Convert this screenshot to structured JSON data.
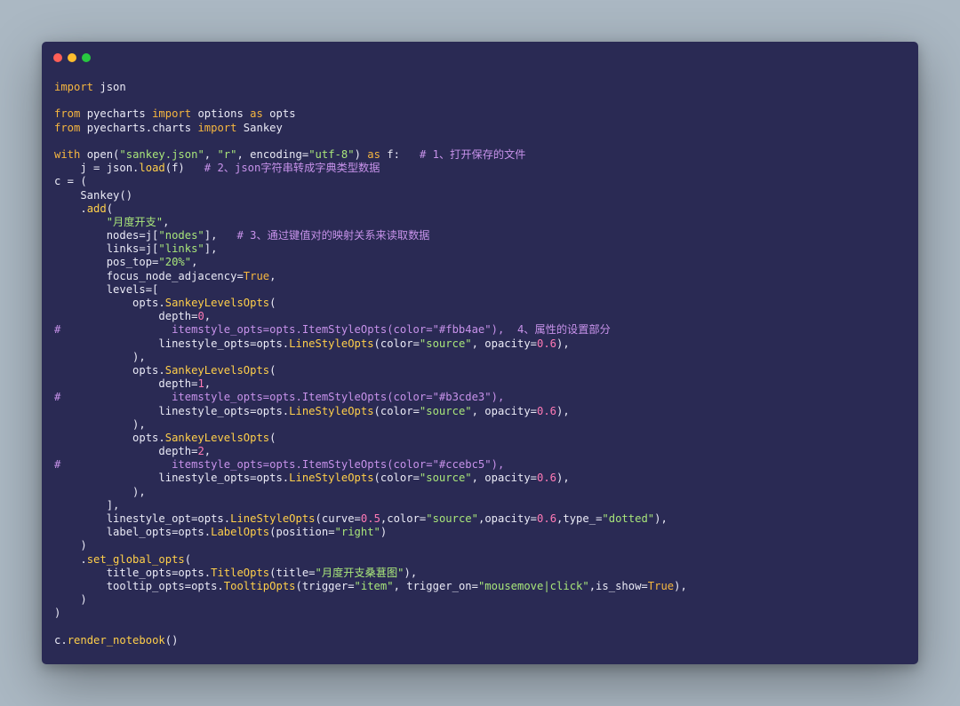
{
  "window": {
    "controls": [
      {
        "name": "close",
        "color": "#ff5f57"
      },
      {
        "name": "minimize",
        "color": "#ffbd2e"
      },
      {
        "name": "maximize",
        "color": "#28c840"
      }
    ]
  },
  "colors": {
    "background": "#abb8c3",
    "editor": "#2a2a54",
    "keyword": "#f6b63f",
    "string": "#a8e57a",
    "number": "#ff7ab6",
    "function": "#ffcf4a",
    "comment": "#c792ea",
    "text": "#eaeaf6"
  },
  "code": {
    "lines": [
      [
        {
          "t": "import",
          "c": "kw"
        },
        {
          "t": " json",
          "c": "id"
        }
      ],
      [],
      [
        {
          "t": "from",
          "c": "kw"
        },
        {
          "t": " pyecharts ",
          "c": "id"
        },
        {
          "t": "import",
          "c": "kw"
        },
        {
          "t": " options ",
          "c": "id"
        },
        {
          "t": "as",
          "c": "kw"
        },
        {
          "t": " opts",
          "c": "id"
        }
      ],
      [
        {
          "t": "from",
          "c": "kw"
        },
        {
          "t": " pyecharts.charts ",
          "c": "id"
        },
        {
          "t": "import",
          "c": "kw"
        },
        {
          "t": " Sankey",
          "c": "id"
        }
      ],
      [],
      [
        {
          "t": "with",
          "c": "kw"
        },
        {
          "t": " open(",
          "c": "id"
        },
        {
          "t": "\"sankey.json\"",
          "c": "str"
        },
        {
          "t": ", ",
          "c": "id"
        },
        {
          "t": "\"r\"",
          "c": "str"
        },
        {
          "t": ", encoding=",
          "c": "id"
        },
        {
          "t": "\"utf-8\"",
          "c": "str"
        },
        {
          "t": ") ",
          "c": "id"
        },
        {
          "t": "as",
          "c": "kw"
        },
        {
          "t": " f:   ",
          "c": "id"
        },
        {
          "t": "# 1、打开保存的文件",
          "c": "cm"
        }
      ],
      [
        {
          "t": "    j = json.",
          "c": "id"
        },
        {
          "t": "load",
          "c": "fn"
        },
        {
          "t": "(f)   ",
          "c": "id"
        },
        {
          "t": "# 2、json字符串转成字典类型数据",
          "c": "cm"
        }
      ],
      [
        {
          "t": "c = (",
          "c": "id"
        }
      ],
      [
        {
          "t": "    Sankey()",
          "c": "id"
        }
      ],
      [
        {
          "t": "    .",
          "c": "id"
        },
        {
          "t": "add",
          "c": "fn"
        },
        {
          "t": "(",
          "c": "id"
        }
      ],
      [
        {
          "t": "        ",
          "c": "id"
        },
        {
          "t": "\"月度开支\"",
          "c": "str"
        },
        {
          "t": ",",
          "c": "id"
        }
      ],
      [
        {
          "t": "        nodes=j[",
          "c": "id"
        },
        {
          "t": "\"nodes\"",
          "c": "str"
        },
        {
          "t": "],   ",
          "c": "id"
        },
        {
          "t": "# 3、通过键值对的映射关系来读取数据",
          "c": "cm"
        }
      ],
      [
        {
          "t": "        links=j[",
          "c": "id"
        },
        {
          "t": "\"links\"",
          "c": "str"
        },
        {
          "t": "],",
          "c": "id"
        }
      ],
      [
        {
          "t": "        pos_top=",
          "c": "id"
        },
        {
          "t": "\"20%\"",
          "c": "str"
        },
        {
          "t": ",",
          "c": "id"
        }
      ],
      [
        {
          "t": "        focus_node_adjacency=",
          "c": "id"
        },
        {
          "t": "True",
          "c": "kw"
        },
        {
          "t": ",",
          "c": "id"
        }
      ],
      [
        {
          "t": "        levels=[",
          "c": "id"
        }
      ],
      [
        {
          "t": "            opts.",
          "c": "id"
        },
        {
          "t": "SankeyLevelsOpts",
          "c": "fn"
        },
        {
          "t": "(",
          "c": "id"
        }
      ],
      [
        {
          "t": "                depth=",
          "c": "id"
        },
        {
          "t": "0",
          "c": "num"
        },
        {
          "t": ",",
          "c": "id"
        }
      ],
      [
        {
          "t": "#                 itemstyle_opts=opts.ItemStyleOpts(color=\"#fbb4ae\"),  4、属性的设置部分",
          "c": "cm"
        }
      ],
      [
        {
          "t": "                linestyle_opts=opts.",
          "c": "id"
        },
        {
          "t": "LineStyleOpts",
          "c": "fn"
        },
        {
          "t": "(color=",
          "c": "id"
        },
        {
          "t": "\"source\"",
          "c": "str"
        },
        {
          "t": ", opacity=",
          "c": "id"
        },
        {
          "t": "0.6",
          "c": "num"
        },
        {
          "t": "),",
          "c": "id"
        }
      ],
      [
        {
          "t": "            ),",
          "c": "id"
        }
      ],
      [
        {
          "t": "            opts.",
          "c": "id"
        },
        {
          "t": "SankeyLevelsOpts",
          "c": "fn"
        },
        {
          "t": "(",
          "c": "id"
        }
      ],
      [
        {
          "t": "                depth=",
          "c": "id"
        },
        {
          "t": "1",
          "c": "num"
        },
        {
          "t": ",",
          "c": "id"
        }
      ],
      [
        {
          "t": "#                 itemstyle_opts=opts.ItemStyleOpts(color=\"#b3cde3\"),",
          "c": "cm"
        }
      ],
      [
        {
          "t": "                linestyle_opts=opts.",
          "c": "id"
        },
        {
          "t": "LineStyleOpts",
          "c": "fn"
        },
        {
          "t": "(color=",
          "c": "id"
        },
        {
          "t": "\"source\"",
          "c": "str"
        },
        {
          "t": ", opacity=",
          "c": "id"
        },
        {
          "t": "0.6",
          "c": "num"
        },
        {
          "t": "),",
          "c": "id"
        }
      ],
      [
        {
          "t": "            ),",
          "c": "id"
        }
      ],
      [
        {
          "t": "            opts.",
          "c": "id"
        },
        {
          "t": "SankeyLevelsOpts",
          "c": "fn"
        },
        {
          "t": "(",
          "c": "id"
        }
      ],
      [
        {
          "t": "                depth=",
          "c": "id"
        },
        {
          "t": "2",
          "c": "num"
        },
        {
          "t": ",",
          "c": "id"
        }
      ],
      [
        {
          "t": "#                 itemstyle_opts=opts.ItemStyleOpts(color=\"#ccebc5\"),",
          "c": "cm"
        }
      ],
      [
        {
          "t": "                linestyle_opts=opts.",
          "c": "id"
        },
        {
          "t": "LineStyleOpts",
          "c": "fn"
        },
        {
          "t": "(color=",
          "c": "id"
        },
        {
          "t": "\"source\"",
          "c": "str"
        },
        {
          "t": ", opacity=",
          "c": "id"
        },
        {
          "t": "0.6",
          "c": "num"
        },
        {
          "t": "),",
          "c": "id"
        }
      ],
      [
        {
          "t": "            ),",
          "c": "id"
        }
      ],
      [
        {
          "t": "        ],",
          "c": "id"
        }
      ],
      [
        {
          "t": "        linestyle_opt=opts.",
          "c": "id"
        },
        {
          "t": "LineStyleOpts",
          "c": "fn"
        },
        {
          "t": "(curve=",
          "c": "id"
        },
        {
          "t": "0.5",
          "c": "num"
        },
        {
          "t": ",color=",
          "c": "id"
        },
        {
          "t": "\"source\"",
          "c": "str"
        },
        {
          "t": ",opacity=",
          "c": "id"
        },
        {
          "t": "0.6",
          "c": "num"
        },
        {
          "t": ",type_=",
          "c": "id"
        },
        {
          "t": "\"dotted\"",
          "c": "str"
        },
        {
          "t": "),",
          "c": "id"
        }
      ],
      [
        {
          "t": "        label_opts=opts.",
          "c": "id"
        },
        {
          "t": "LabelOpts",
          "c": "fn"
        },
        {
          "t": "(position=",
          "c": "id"
        },
        {
          "t": "\"right\"",
          "c": "str"
        },
        {
          "t": ")",
          "c": "id"
        }
      ],
      [
        {
          "t": "    )",
          "c": "id"
        }
      ],
      [
        {
          "t": "    .",
          "c": "id"
        },
        {
          "t": "set_global_opts",
          "c": "fn"
        },
        {
          "t": "(",
          "c": "id"
        }
      ],
      [
        {
          "t": "        title_opts=opts.",
          "c": "id"
        },
        {
          "t": "TitleOpts",
          "c": "fn"
        },
        {
          "t": "(title=",
          "c": "id"
        },
        {
          "t": "\"月度开支桑葚图\"",
          "c": "str"
        },
        {
          "t": "),",
          "c": "id"
        }
      ],
      [
        {
          "t": "        tooltip_opts=opts.",
          "c": "id"
        },
        {
          "t": "TooltipOpts",
          "c": "fn"
        },
        {
          "t": "(trigger=",
          "c": "id"
        },
        {
          "t": "\"item\"",
          "c": "str"
        },
        {
          "t": ", trigger_on=",
          "c": "id"
        },
        {
          "t": "\"mousemove|click\"",
          "c": "str"
        },
        {
          "t": ",is_show=",
          "c": "id"
        },
        {
          "t": "True",
          "c": "kw"
        },
        {
          "t": "),",
          "c": "id"
        }
      ],
      [
        {
          "t": "    )",
          "c": "id"
        }
      ],
      [
        {
          "t": ")",
          "c": "id"
        }
      ],
      [],
      [
        {
          "t": "c.",
          "c": "id"
        },
        {
          "t": "render_notebook",
          "c": "fn"
        },
        {
          "t": "()",
          "c": "id"
        }
      ]
    ]
  }
}
